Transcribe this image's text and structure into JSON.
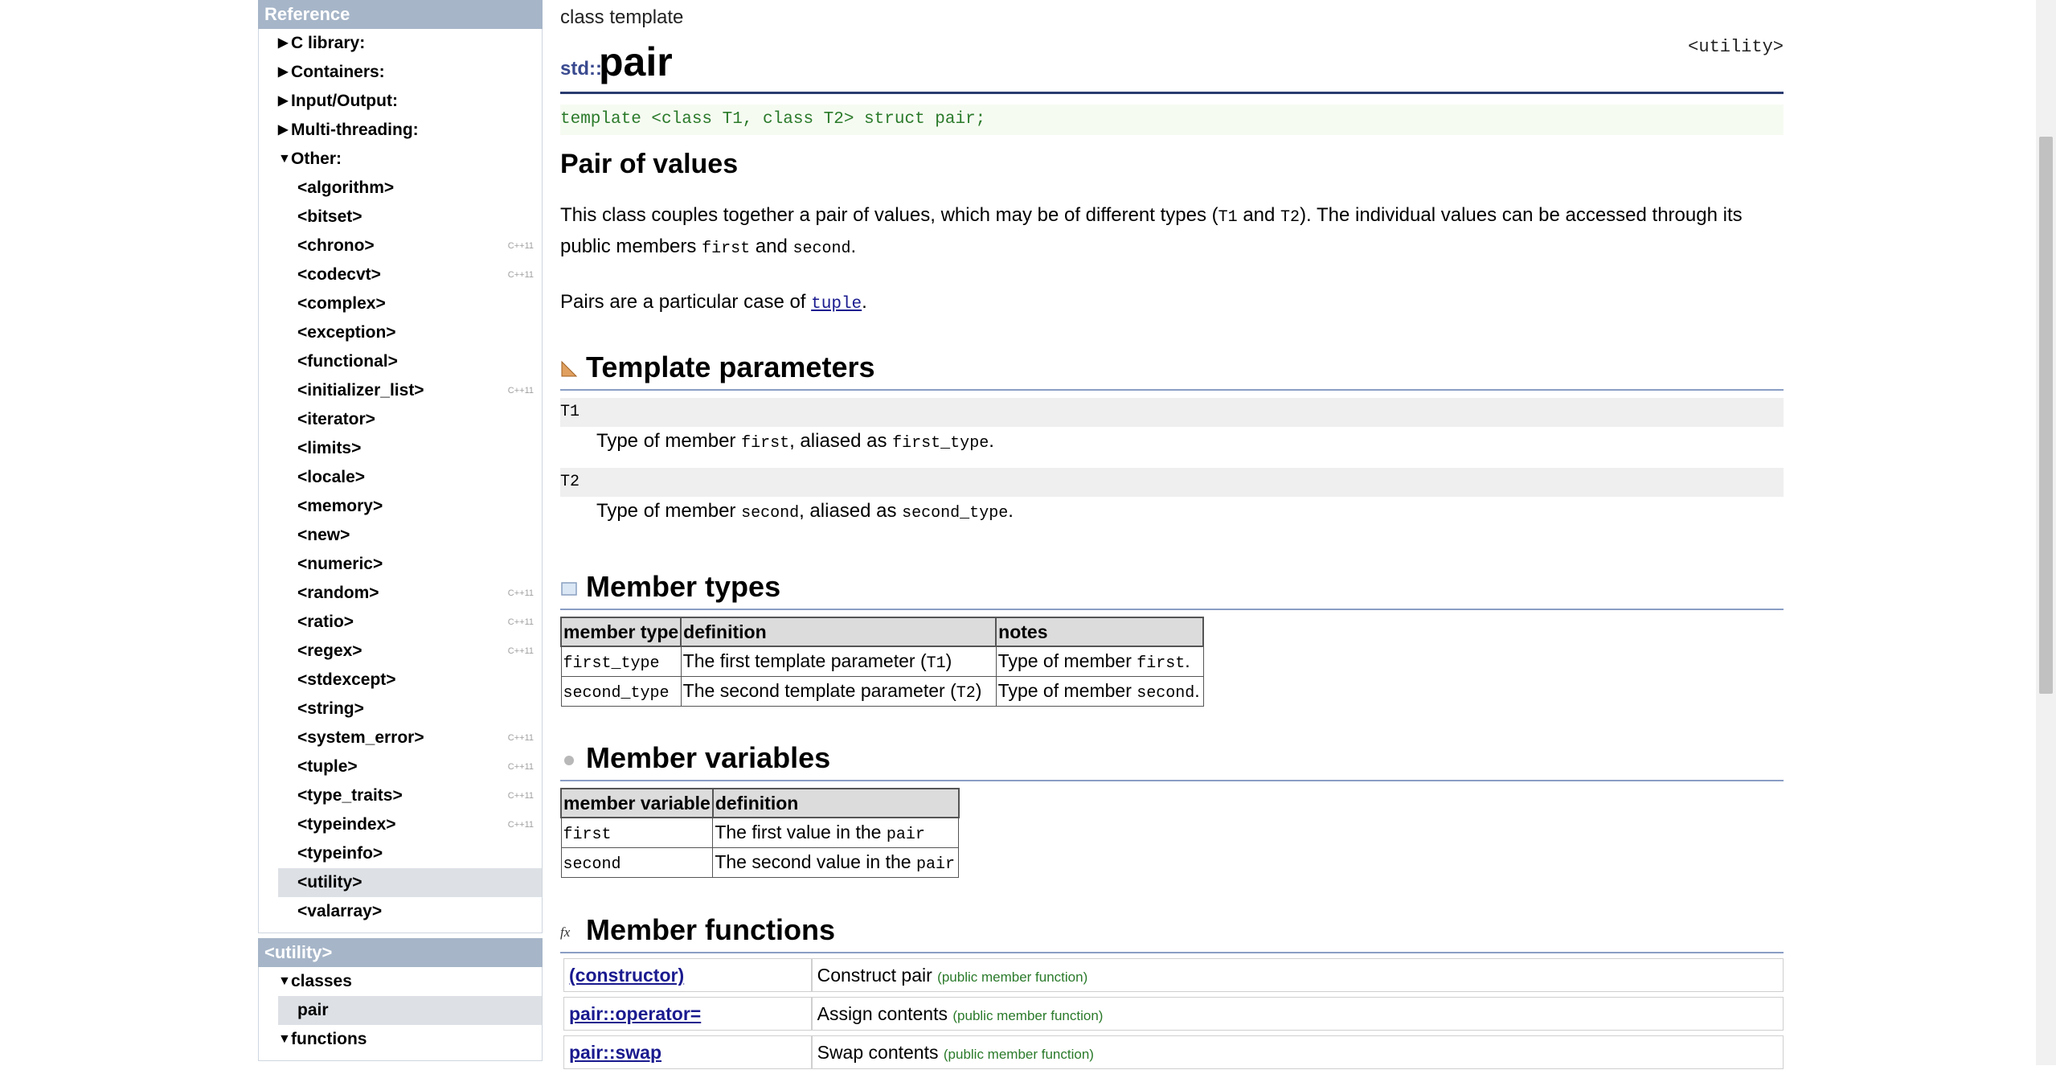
{
  "sidebar": {
    "reference_header": "Reference",
    "groups": [
      {
        "label": "C library:",
        "expanded": false
      },
      {
        "label": "Containers:",
        "expanded": false
      },
      {
        "label": "Input/Output:",
        "expanded": false
      },
      {
        "label": "Multi-threading:",
        "expanded": false
      },
      {
        "label": "Other:",
        "expanded": true
      }
    ],
    "headers": [
      {
        "label": "<algorithm>",
        "cpp11": ""
      },
      {
        "label": "<bitset>",
        "cpp11": ""
      },
      {
        "label": "<chrono>",
        "cpp11": "C++11"
      },
      {
        "label": "<codecvt>",
        "cpp11": "C++11"
      },
      {
        "label": "<complex>",
        "cpp11": ""
      },
      {
        "label": "<exception>",
        "cpp11": ""
      },
      {
        "label": "<functional>",
        "cpp11": ""
      },
      {
        "label": "<initializer_list>",
        "cpp11": "C++11"
      },
      {
        "label": "<iterator>",
        "cpp11": ""
      },
      {
        "label": "<limits>",
        "cpp11": ""
      },
      {
        "label": "<locale>",
        "cpp11": ""
      },
      {
        "label": "<memory>",
        "cpp11": ""
      },
      {
        "label": "<new>",
        "cpp11": ""
      },
      {
        "label": "<numeric>",
        "cpp11": ""
      },
      {
        "label": "<random>",
        "cpp11": "C++11"
      },
      {
        "label": "<ratio>",
        "cpp11": "C++11"
      },
      {
        "label": "<regex>",
        "cpp11": "C++11"
      },
      {
        "label": "<stdexcept>",
        "cpp11": ""
      },
      {
        "label": "<string>",
        "cpp11": ""
      },
      {
        "label": "<system_error>",
        "cpp11": "C++11"
      },
      {
        "label": "<tuple>",
        "cpp11": "C++11"
      },
      {
        "label": "<type_traits>",
        "cpp11": "C++11"
      },
      {
        "label": "<typeindex>",
        "cpp11": "C++11"
      },
      {
        "label": "<typeinfo>",
        "cpp11": ""
      },
      {
        "label": "<utility>",
        "cpp11": "",
        "selected": true
      },
      {
        "label": "<valarray>",
        "cpp11": ""
      }
    ],
    "utility_header": "<utility>",
    "utility_items": [
      {
        "label": "classes",
        "type": "group"
      },
      {
        "label": "pair",
        "type": "item",
        "selected": true
      },
      {
        "label": "functions",
        "type": "group"
      }
    ]
  },
  "page": {
    "kind": "class template",
    "namespace": "std::",
    "name": "pair",
    "header_ref": "<utility>",
    "prototype": "template <class T1, class T2> struct pair;",
    "heading": "Pair of values",
    "desc1_a": "This class couples together a pair of values, which may be of different types (",
    "desc1_t1": "T1",
    "desc1_and": " and ",
    "desc1_t2": "T2",
    "desc1_b": "). The individual values can be accessed through its",
    "desc2_a": "public members ",
    "desc2_first": "first",
    "desc2_and": " and ",
    "desc2_second": "second",
    "desc2_end": ".",
    "tuple_a": "Pairs are a particular case of ",
    "tuple_link": "tuple",
    "tuple_end": "."
  },
  "template_params": {
    "title": "Template parameters",
    "items": [
      {
        "name": "T1",
        "desc_a": "Type of member ",
        "member": "first",
        "desc_b": ", aliased as ",
        "alias": "first_type",
        "end": "."
      },
      {
        "name": "T2",
        "desc_a": "Type of member ",
        "member": "second",
        "desc_b": ", aliased as ",
        "alias": "second_type",
        "end": "."
      }
    ]
  },
  "member_types": {
    "title": "Member types",
    "headers": [
      "member type",
      "definition",
      "notes"
    ],
    "rows": [
      {
        "type": "first_type",
        "def_a": "The first template parameter (",
        "def_code": "T1",
        "def_b": ")",
        "notes_a": "Type of member ",
        "notes_code": "first",
        "notes_b": "."
      },
      {
        "type": "second_type",
        "def_a": "The second template parameter (",
        "def_code": "T2",
        "def_b": ")",
        "notes_a": "Type of member ",
        "notes_code": "second",
        "notes_b": "."
      }
    ]
  },
  "member_vars": {
    "title": "Member variables",
    "headers": [
      "member variable",
      "definition"
    ],
    "rows": [
      {
        "name": "first",
        "def_a": "The first value in the ",
        "def_code": "pair"
      },
      {
        "name": "second",
        "def_a": "The second value in the ",
        "def_code": "pair"
      }
    ]
  },
  "member_funcs": {
    "title": "Member functions",
    "rows": [
      {
        "name": "(constructor)",
        "desc": "Construct pair",
        "tag": "(public member function)"
      },
      {
        "name": "pair::operator=",
        "desc": "Assign contents",
        "tag": "(public member function)"
      },
      {
        "name": "pair::swap",
        "desc": "Swap contents",
        "tag": "(public member function)"
      }
    ]
  },
  "colors": {
    "accent": "#2a3b6f",
    "link": "#1a1a8f",
    "code_green": "#2a7a2a",
    "sidebar_header": "#a6b5c8"
  }
}
